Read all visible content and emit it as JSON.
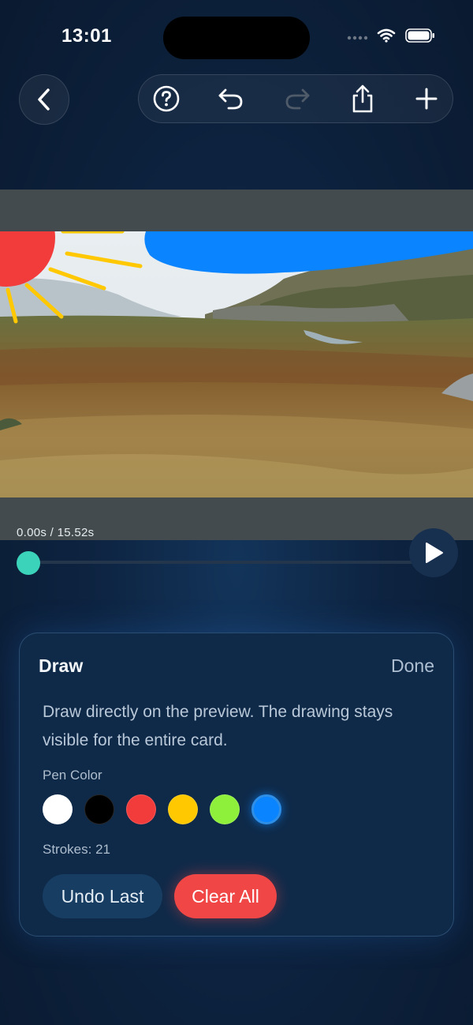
{
  "status_bar": {
    "time": "13:01"
  },
  "toolbar": {
    "back_icon": "chevron-left-icon",
    "buttons": [
      "help-icon",
      "undo-icon",
      "redo-icon",
      "share-icon",
      "plus-icon"
    ]
  },
  "player": {
    "time_label": "0.00s / 15.52s",
    "progress": 0.0,
    "play_icon": "play-icon"
  },
  "draw_panel": {
    "title": "Draw",
    "done_label": "Done",
    "description": "Draw directly on the preview. The drawing stays visible for the entire card.",
    "pen_color_label": "Pen Color",
    "colors": [
      "#ffffff",
      "#000000",
      "#f23c3c",
      "#ffc800",
      "#8ef03a",
      "#0a84ff"
    ],
    "selected_color": "#0a84ff",
    "strokes_label": "Strokes: 21",
    "undo_label": "Undo Last",
    "clear_label": "Clear All"
  },
  "colors": {
    "accent": "#3bd3b9",
    "danger": "#f04646",
    "selected": "#0a84ff"
  }
}
